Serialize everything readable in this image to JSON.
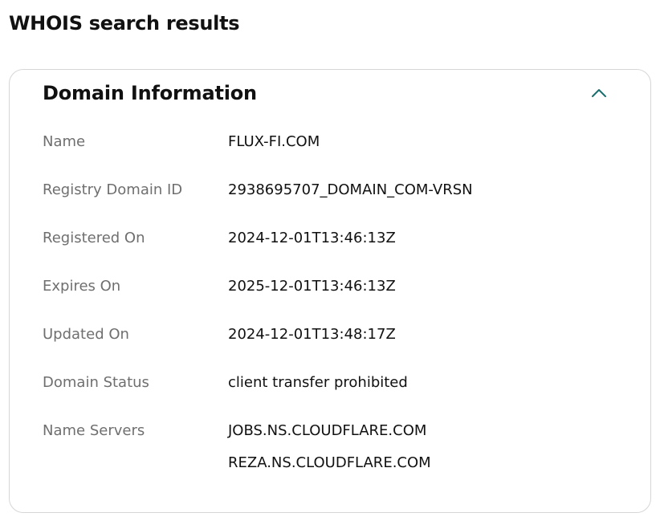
{
  "page": {
    "title": "WHOIS search results"
  },
  "card": {
    "title": "Domain Information",
    "toggle_icon": "chevron-up-icon",
    "accent_color": "#1a6e6e"
  },
  "fields": {
    "name": {
      "label": "Name",
      "value": "FLUX-FI.COM"
    },
    "registry_domain_id": {
      "label": "Registry Domain ID",
      "value": "2938695707_DOMAIN_COM-VRSN"
    },
    "registered_on": {
      "label": "Registered On",
      "value": "2024-12-01T13:46:13Z"
    },
    "expires_on": {
      "label": "Expires On",
      "value": "2025-12-01T13:46:13Z"
    },
    "updated_on": {
      "label": "Updated On",
      "value": "2024-12-01T13:48:17Z"
    },
    "domain_status": {
      "label": "Domain Status",
      "value": "client transfer prohibited"
    },
    "name_servers": {
      "label": "Name Servers",
      "values": [
        "JOBS.NS.CLOUDFLARE.COM",
        "REZA.NS.CLOUDFLARE.COM"
      ]
    }
  }
}
